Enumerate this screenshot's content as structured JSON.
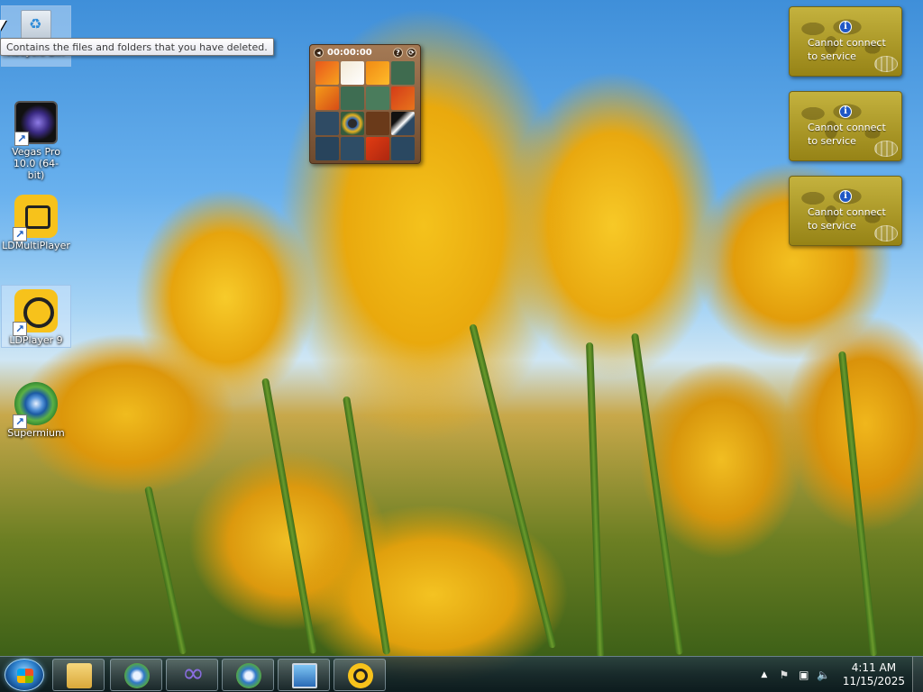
{
  "desktop": {
    "icons": [
      {
        "label": "Recycle Bin"
      },
      {
        "label": "Vegas Pro 10.0 (64-bit)"
      },
      {
        "label": "LDMultiPlayer"
      },
      {
        "label": "LDPlayer 9"
      },
      {
        "label": "Supermium"
      }
    ],
    "tooltip": "Contains the files and folders that you have deleted."
  },
  "puzzle_gadget": {
    "timer": "00:00:00",
    "help_icon": "?",
    "settings_icon": "⟳"
  },
  "weather_gadgets": [
    {
      "line1": "Cannot connect",
      "line2": "to service",
      "icon": "i"
    },
    {
      "line1": "Cannot connect",
      "line2": "to service",
      "icon": "i"
    },
    {
      "line1": "Cannot connect",
      "line2": "to service",
      "icon": "i"
    }
  ],
  "taskbar": {
    "pinned": [
      {
        "name": "Windows Explorer",
        "icon": "folder-icon"
      },
      {
        "name": "Supermium",
        "icon": "supermium-icon"
      },
      {
        "name": "Infinity",
        "icon": "infinity-icon"
      },
      {
        "name": "Supermium",
        "icon": "supermium-icon"
      },
      {
        "name": "Remote Desktop",
        "icon": "monitor-icon"
      },
      {
        "name": "LDPlayer 9",
        "icon": "ldplayer-icon"
      }
    ],
    "tray": {
      "overflow": "▲",
      "time": "4:11 AM",
      "date": "11/15/2025"
    }
  },
  "colors": {
    "taskbar": "#1c2e38",
    "weather_gadget": "#b8a52e",
    "puzzle_frame": "#8a6040",
    "tooltip_border": "#767676"
  }
}
